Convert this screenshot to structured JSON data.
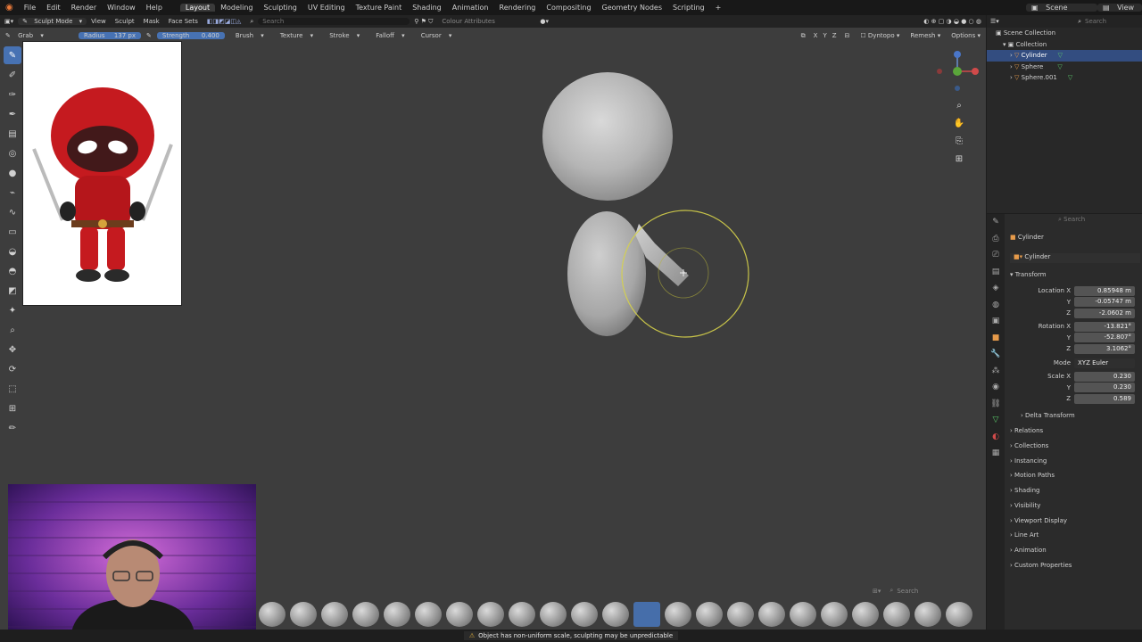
{
  "topbar": {
    "menus": [
      "File",
      "Edit",
      "Render",
      "Window",
      "Help"
    ],
    "workspaces": [
      "Layout",
      "Modeling",
      "Sculpting",
      "UV Editing",
      "Texture Paint",
      "Shading",
      "Animation",
      "Rendering",
      "Compositing",
      "Geometry Nodes",
      "Scripting"
    ],
    "active_workspace": "Layout",
    "add_tab": "+",
    "scene": "Scene",
    "view_layer": "View"
  },
  "header": {
    "mode": "Sculpt Mode",
    "menus": [
      "View",
      "Sculpt",
      "Mask",
      "Face Sets"
    ],
    "search_placeholder": "Search",
    "colour_attributes": "Colour Attributes"
  },
  "tool_settings": {
    "brush_name": "Grab",
    "radius_label": "Radius",
    "radius_value": "137 px",
    "strength_label": "Strength",
    "strength_value": "0.400",
    "brush_menu": "Brush",
    "texture_menu": "Texture",
    "stroke_menu": "Stroke",
    "falloff_menu": "Falloff",
    "cursor_menu": "Cursor",
    "axes": [
      "X",
      "Y",
      "Z"
    ],
    "dyntopo": "Dyntopo",
    "remesh": "Remesh",
    "options": "Options"
  },
  "outliner": {
    "search_placeholder": "Search",
    "scene_collection": "Scene Collection",
    "collection": "Collection",
    "objects": [
      "Cylinder",
      "Sphere",
      "Sphere.001"
    ],
    "selected": "Cylinder"
  },
  "properties": {
    "search_placeholder": "Search",
    "object_name": "Cylinder",
    "object_field": "Cylinder",
    "transform_label": "Transform",
    "location_label": "Location X",
    "location": [
      "0.85948 m",
      "-0.05747 m",
      "-2.0602 m"
    ],
    "rotation_label": "Rotation X",
    "rotation": [
      "-13.821°",
      "-52.807°",
      "3.1062°"
    ],
    "mode_label": "Mode",
    "mode_value": "XYZ Euler",
    "scale_label": "Scale X",
    "scale": [
      "0.230",
      "0.230",
      "0.589"
    ],
    "y_label": "Y",
    "z_label": "Z",
    "delta_transform": "Delta Transform",
    "sections": [
      "Relations",
      "Collections",
      "Instancing",
      "Motion Paths",
      "Shading",
      "Visibility",
      "Viewport Display",
      "Line Art",
      "Animation",
      "Custom Properties"
    ]
  },
  "brush_panel": {
    "search_placeholder": "Search"
  },
  "status": {
    "warning": "Object has non-uniform scale, sculpting may be unpredictable"
  },
  "colors": {
    "accent": "#4772b3",
    "viewport": "#3d3d3d",
    "brush_circle": "#d6d24a"
  }
}
